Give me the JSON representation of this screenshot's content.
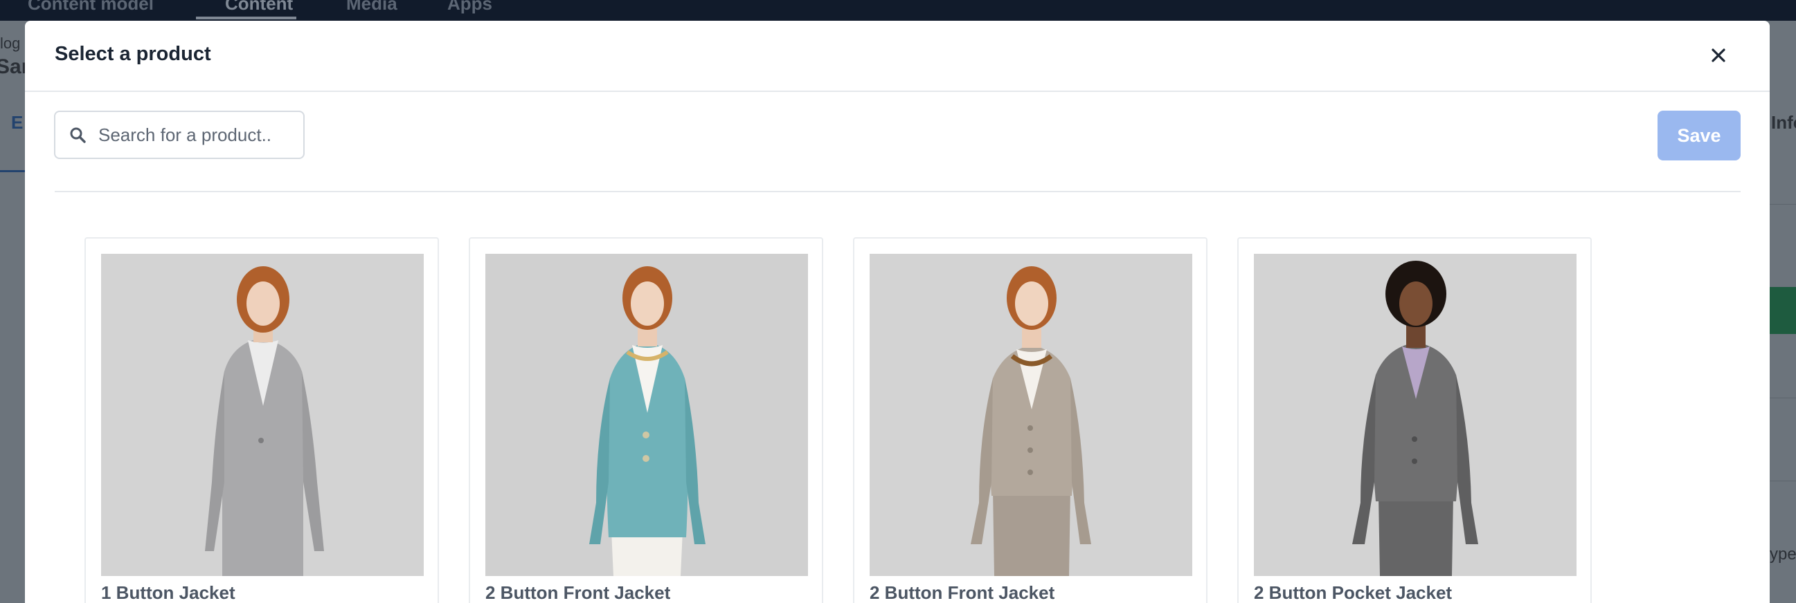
{
  "background": {
    "nav": [
      "Content model",
      "Content",
      "Media",
      "Apps"
    ],
    "left_texts": [
      "log",
      "Sam",
      "E"
    ],
    "right_texts": [
      "Info",
      "ype"
    ]
  },
  "modal": {
    "title": "Select a product",
    "close_icon": "close-icon"
  },
  "search": {
    "placeholder": "Search for a product..",
    "value": "",
    "icon": "search-icon"
  },
  "toolbar": {
    "save_label": "Save",
    "save_color": "#9ab8ef"
  },
  "products": [
    {
      "title": "1 Button Jacket",
      "jacket_color": "#a8a8aa"
    },
    {
      "title": "2 Button Front Jacket",
      "jacket_color": "#6fb2b9"
    },
    {
      "title": "2 Button Front Jacket",
      "jacket_color": "#b3a89c"
    },
    {
      "title": "2 Button Pocket Jacket",
      "jacket_color": "#6f6f70"
    }
  ]
}
